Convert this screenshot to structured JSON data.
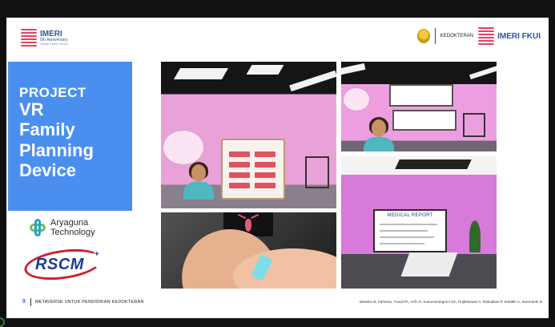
{
  "header": {
    "left_logo": {
      "title": "IMERI",
      "subtitle": "5th Anniversary",
      "tagline": "Virtual Open House"
    },
    "right": {
      "faculty_label": "KEDOKTERAN",
      "fkui_logo": "IMERI FKUI"
    }
  },
  "project": {
    "line1": "PROJECT",
    "line2": "VR",
    "line3": "Family",
    "line4": "Planning",
    "line5": "Device"
  },
  "partners": {
    "aryaguna_line1": "Aryaguna",
    "aryaguna_line2": "Technology",
    "rscm": "RSCM"
  },
  "vr_panels": {
    "medical_report": "MEDICAL REPORT"
  },
  "footer": {
    "page_number": "9",
    "title": "METAVERSE UNTUK PENDIDIKAN KEDOKTERAN",
    "authors": "Wiweko B, Fahreza, Yusuf PA, Arif LS, Kusumoningrum DA, Pujitresnani A, Rahadiani P, Kekalih A, Soemantri D"
  },
  "colors": {
    "accent_blue": "#4a8ff0",
    "imeri_red": "#e2435e",
    "rscm_blue": "#1b3d8f",
    "rscm_red": "#d0202e"
  }
}
